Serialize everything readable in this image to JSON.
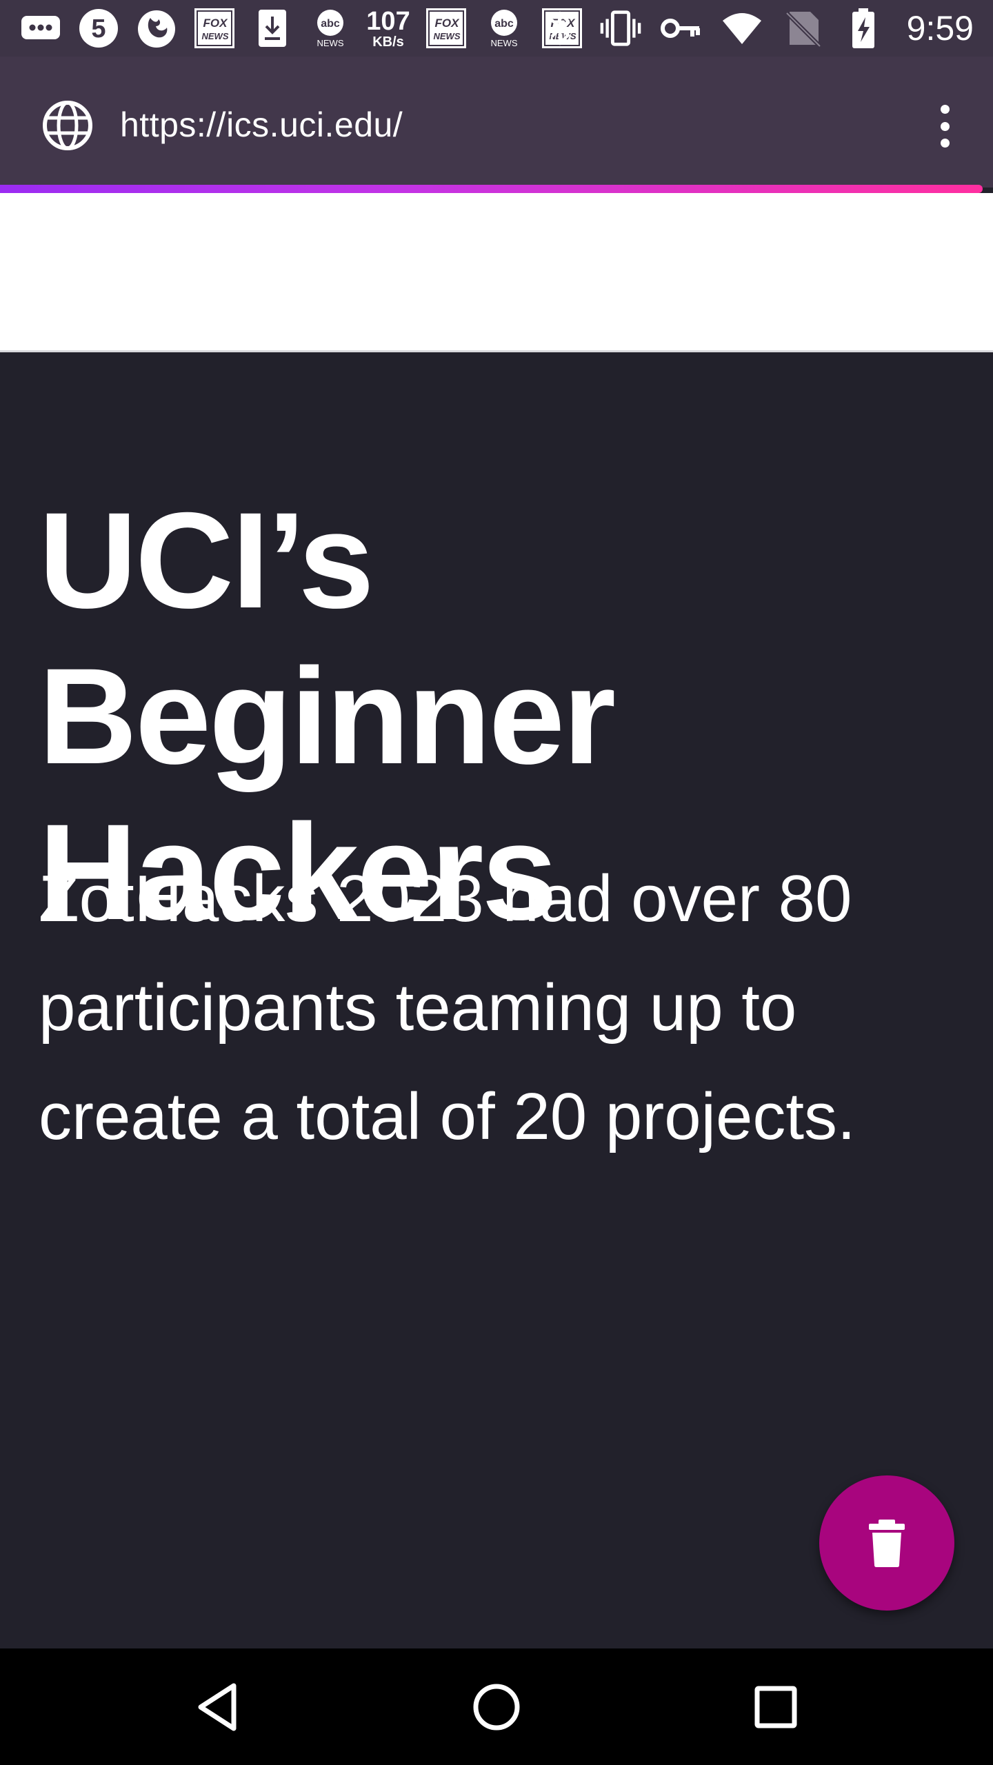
{
  "status_bar": {
    "left_icons": [
      "message-dots-icon",
      "channel-5-icon",
      "firefox-icon",
      "fox-news-icon",
      "download-icon",
      "abc-news-icon",
      "network-speed",
      "fox-news-icon",
      "abc-news-icon",
      "fox-news-icon"
    ],
    "abc_label": "abc",
    "news_label": "NEWS",
    "fox_label": "FOX",
    "speed_value": "107",
    "speed_unit": "KB/s",
    "channel_number": "5",
    "right_icons": [
      "bluetooth-icon",
      "vibrate-icon",
      "vpn-key-icon",
      "wifi-icon",
      "no-signal-icon",
      "battery-charging-icon"
    ],
    "time": "9:59"
  },
  "browser": {
    "url": "https://ics.uci.edu/",
    "site_icon": "globe-icon",
    "menu_icon": "more-vert-icon",
    "progress_gradient": [
      "#9b2cf2",
      "#ff2fa0"
    ]
  },
  "page": {
    "hero_title": "UCI’s Beginner Hackers",
    "hero_text": "ZotHacks 2023 had over 80 participants teaming up to create a total of 20 projects."
  },
  "fab": {
    "icon": "trash-icon",
    "color": "#a8057e"
  },
  "nav_bar": {
    "buttons": [
      "back-icon",
      "home-icon",
      "recents-icon"
    ]
  },
  "colors": {
    "status_bar": "#3d3446",
    "url_bar": "#42374b",
    "hero_background": "#22212b",
    "text": "#ffffff"
  }
}
